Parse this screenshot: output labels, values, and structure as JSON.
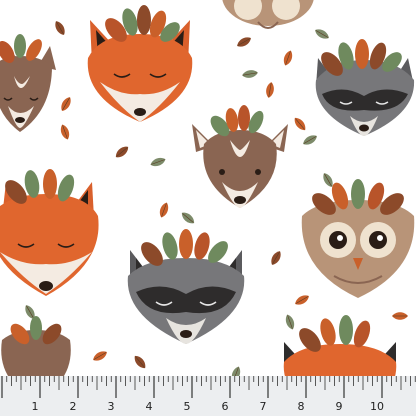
{
  "scene": {
    "description_icons": [
      "fox-face-icon",
      "deer-face-icon",
      "raccoon-face-icon",
      "owl-face-icon",
      "leaf-icon"
    ],
    "background_color": "#ffffff",
    "fox_orange": "#d9602c",
    "raccoon_gray": "#6b6b6e",
    "deer_brown": "#8a6552",
    "owl_tan": "#b89478",
    "leaf_green": "#6f8a5e",
    "leaf_rust": "#b8542a"
  },
  "ruler": {
    "labels": [
      "1",
      "2",
      "3",
      "4",
      "5",
      "6",
      "7",
      "8",
      "9",
      "10"
    ]
  }
}
